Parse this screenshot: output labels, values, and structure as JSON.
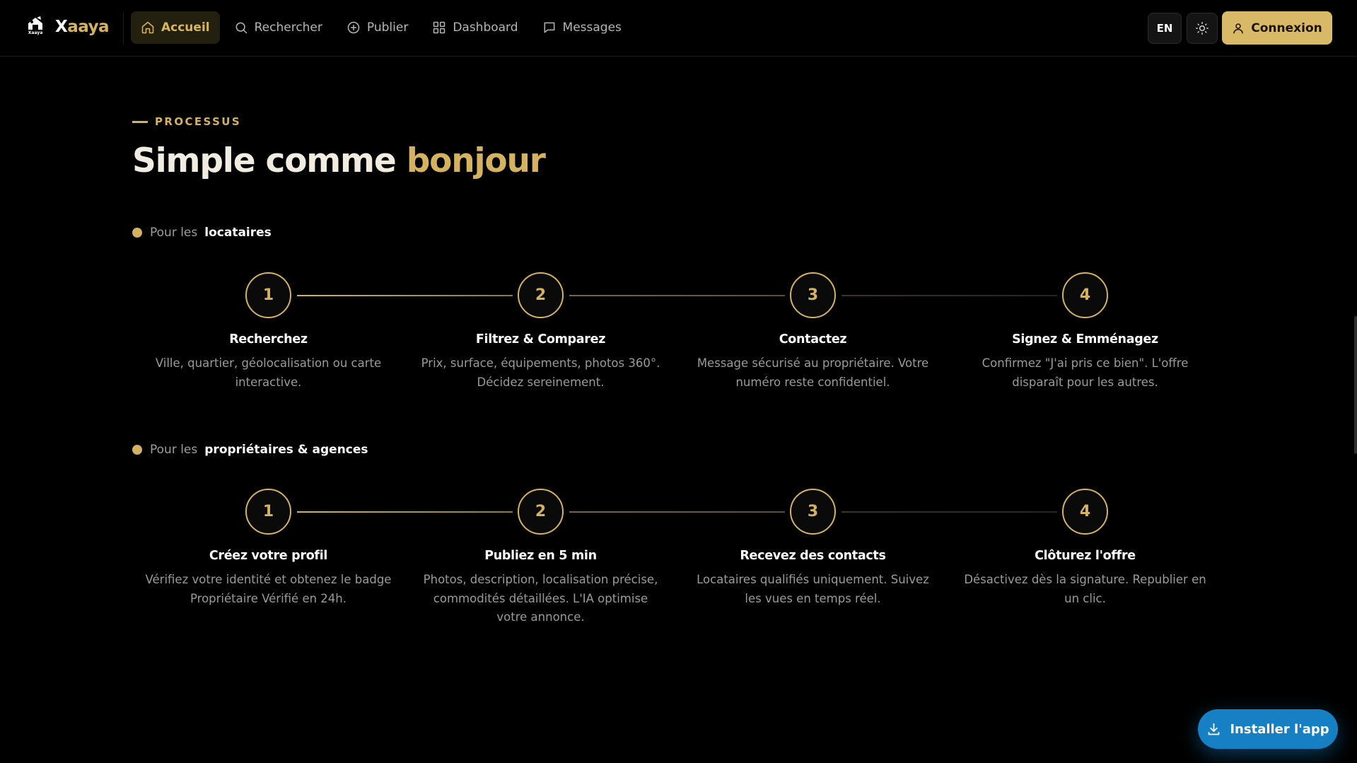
{
  "header": {
    "logo_caption": "Xaaya",
    "brand_first": "X",
    "brand_rest": "aaya",
    "nav": [
      {
        "label": "Accueil",
        "icon": "home-icon",
        "active": true
      },
      {
        "label": "Rechercher",
        "icon": "search-icon",
        "active": false
      },
      {
        "label": "Publier",
        "icon": "plus-circle-icon",
        "active": false
      },
      {
        "label": "Dashboard",
        "icon": "grid-icon",
        "active": false
      },
      {
        "label": "Messages",
        "icon": "message-icon",
        "active": false
      }
    ],
    "lang_label": "EN",
    "theme_icon": "sun-icon",
    "login_label": "Connexion",
    "login_icon": "user-icon"
  },
  "section": {
    "eyebrow": "PROCESSUS",
    "title_plain": "Simple comme",
    "title_accent": "bonjour",
    "groups": [
      {
        "prefix": "Pour les",
        "audience": "locataires",
        "steps": [
          {
            "number": "1",
            "title": "Recherchez",
            "desc": "Ville, quartier, géolocalisation ou carte interactive."
          },
          {
            "number": "2",
            "title": "Filtrez & Comparez",
            "desc": "Prix, surface, équipements, photos 360°. Décidez sereinement."
          },
          {
            "number": "3",
            "title": "Contactez",
            "desc": "Message sécurisé au propriétaire. Votre numéro reste confidentiel."
          },
          {
            "number": "4",
            "title": "Signez & Emménagez",
            "desc": "Confirmez \"J'ai pris ce bien\". L'offre disparaît pour les autres."
          }
        ]
      },
      {
        "prefix": "Pour les",
        "audience": "propriétaires & agences",
        "steps": [
          {
            "number": "1",
            "title": "Créez votre profil",
            "desc": "Vérifiez votre identité et obtenez le badge Propriétaire Vérifié en 24h."
          },
          {
            "number": "2",
            "title": "Publiez en 5 min",
            "desc": "Photos, description, localisation précise, commodités détaillées. L'IA optimise votre annonce."
          },
          {
            "number": "3",
            "title": "Recevez des contacts",
            "desc": "Locataires qualifiés uniquement. Suivez les vues en temps réel."
          },
          {
            "number": "4",
            "title": "Clôturez l'offre",
            "desc": "Désactivez dès la signature. Republier en un clic."
          }
        ]
      }
    ]
  },
  "install_label": "Installer l'app",
  "install_icon": "download-icon",
  "colors": {
    "accent_gold": "#d4b25f",
    "background": "#000000",
    "install_blue": "#1680c4"
  }
}
